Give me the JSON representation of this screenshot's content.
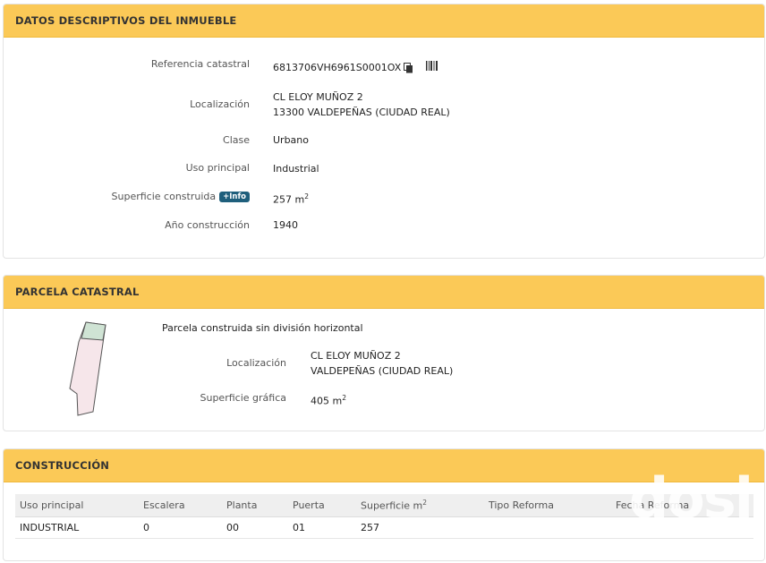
{
  "datos": {
    "title": "DATOS DESCRIPTIVOS DEL INMUEBLE",
    "ref_label": "Referencia catastral",
    "ref_value": "6813706VH6961S0001OX",
    "loc_label": "Localización",
    "loc_line1": "CL ELOY MUÑOZ 2",
    "loc_line2": "13300 VALDEPEÑAS (CIUDAD REAL)",
    "clase_label": "Clase",
    "clase_value": "Urbano",
    "uso_label": "Uso principal",
    "uso_value": "Industrial",
    "sup_label": "Superficie construida",
    "info_badge": "+Info",
    "sup_value": "257 m",
    "sup_exp": "2",
    "anio_label": "Año construcción",
    "anio_value": "1940"
  },
  "parcela": {
    "title": "PARCELA CATASTRAL",
    "subtitle": "Parcela construida sin división horizontal",
    "loc_label": "Localización",
    "loc_line1": "CL ELOY MUÑOZ 2",
    "loc_line2": "VALDEPEÑAS (CIUDAD REAL)",
    "sup_label": "Superficie gráfica",
    "sup_value": "405 m",
    "sup_exp": "2"
  },
  "construccion": {
    "title": "CONSTRUCCIÓN",
    "headers": [
      "Uso principal",
      "Escalera",
      "Planta",
      "Puerta",
      "Superficie m",
      "Tipo Reforma",
      "Fecha Reforma"
    ],
    "sup_header_exp": "2",
    "rows": [
      [
        "INDUSTRIAL",
        "0",
        "00",
        "01",
        "257",
        "",
        ""
      ]
    ],
    "watermark": "dosi"
  },
  "colors": {
    "header_bg": "#fbc957",
    "badge_bg": "#1f5f7c",
    "parcel_fill": "#f6e6ea",
    "parcel_built": "#cfe3d4"
  }
}
